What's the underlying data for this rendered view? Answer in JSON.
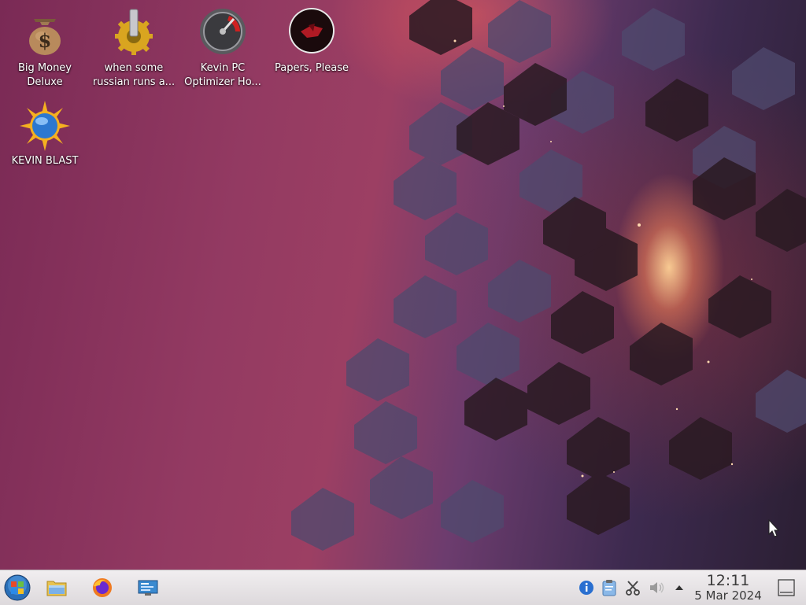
{
  "desktop": {
    "icons": [
      {
        "label": "Big Money\nDeluxe",
        "icon": "money-bag-icon"
      },
      {
        "label": "when some\nrussian runs a...",
        "icon": "gear-icon"
      },
      {
        "label": "Kevin PC\nOptimizer Ho...",
        "icon": "gauge-icon"
      },
      {
        "label": "Papers, Please",
        "icon": "papers-please-icon"
      },
      {
        "label": "KEVIN BLAST",
        "icon": "sun-globe-icon"
      }
    ]
  },
  "taskbar": {
    "launchers": [
      {
        "icon": "start-menu-icon"
      },
      {
        "icon": "file-manager-icon"
      },
      {
        "icon": "firefox-icon"
      },
      {
        "icon": "remote-desktop-icon"
      }
    ],
    "tray": [
      {
        "icon": "info-icon"
      },
      {
        "icon": "clipboard-icon"
      },
      {
        "icon": "scissors-icon"
      },
      {
        "icon": "volume-icon"
      },
      {
        "icon": "expand-tray-arrow-icon"
      }
    ],
    "clock": {
      "time": "12:11",
      "date": "5 Mar 2024"
    },
    "show_desktop_icon": "show-desktop-icon"
  },
  "colors": {
    "taskbar_bg": "#e6e2e5",
    "label_text": "#ffffff",
    "wallpaper_magenta": "#933a62",
    "wallpaper_dark": "#2b1f33"
  }
}
